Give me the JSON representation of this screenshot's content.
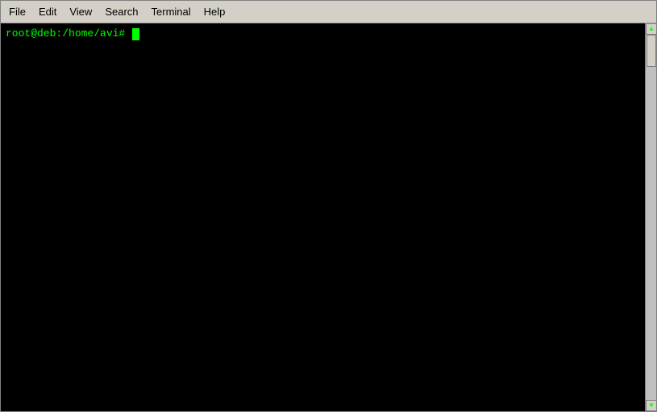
{
  "menubar": {
    "items": [
      {
        "id": "file",
        "label": "File"
      },
      {
        "id": "edit",
        "label": "Edit"
      },
      {
        "id": "view",
        "label": "View"
      },
      {
        "id": "search",
        "label": "Search"
      },
      {
        "id": "terminal",
        "label": "Terminal"
      },
      {
        "id": "help",
        "label": "Help"
      }
    ]
  },
  "terminal": {
    "prompt": "root@deb:/home/avi# "
  }
}
